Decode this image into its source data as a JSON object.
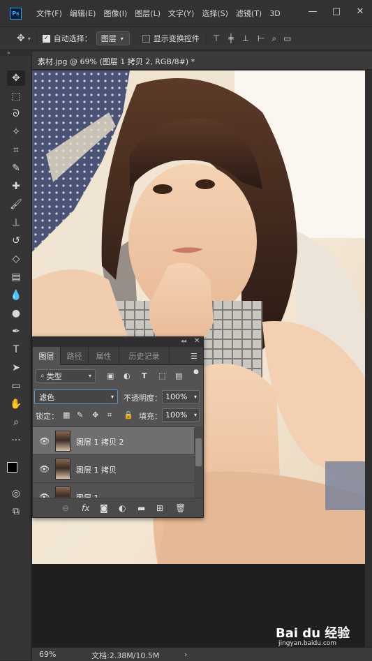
{
  "menubar": {
    "app_icon": "Ps",
    "items": [
      "文件(F)",
      "编辑(E)",
      "图像(I)",
      "图层(L)",
      "文字(Y)",
      "选择(S)",
      "滤镜(T)",
      "3D"
    ],
    "window_controls": [
      "—",
      "□",
      "✕"
    ]
  },
  "options": {
    "auto_select_label": "自动选择：",
    "auto_select_checked": true,
    "target_value": "图层",
    "show_transform_label": "显示变换控件",
    "show_transform_checked": false
  },
  "document": {
    "tab_title": "素材.jpg @ 69% (图层 1 拷贝 2, RGB/8#) *"
  },
  "status": {
    "zoom": "69%",
    "doc_size": "文档:2.38M/10.5M",
    "arrow": "›"
  },
  "layers_panel": {
    "tabs": [
      "图层",
      "路径",
      "属性",
      "历史记录"
    ],
    "active_tab": "图层",
    "filter_type": "类型",
    "blend_mode": "滤色",
    "opacity_label": "不透明度：",
    "opacity_value": "100%",
    "lock_label": "锁定：",
    "fill_label": "填充：",
    "fill_value": "100%",
    "layers": [
      {
        "name": "图层 1 拷贝 2",
        "visible": true,
        "selected": true
      },
      {
        "name": "图层 1 拷贝",
        "visible": true,
        "selected": false
      },
      {
        "name": "图层 1",
        "visible": true,
        "selected": false
      }
    ]
  },
  "watermark": {
    "brand": "Bai du 经验",
    "url": "jingyan.baidu.com"
  },
  "colors": {
    "accent": "#31a8ff",
    "panel_bg": "#535353",
    "selected_layer": "#6f6f6f"
  }
}
